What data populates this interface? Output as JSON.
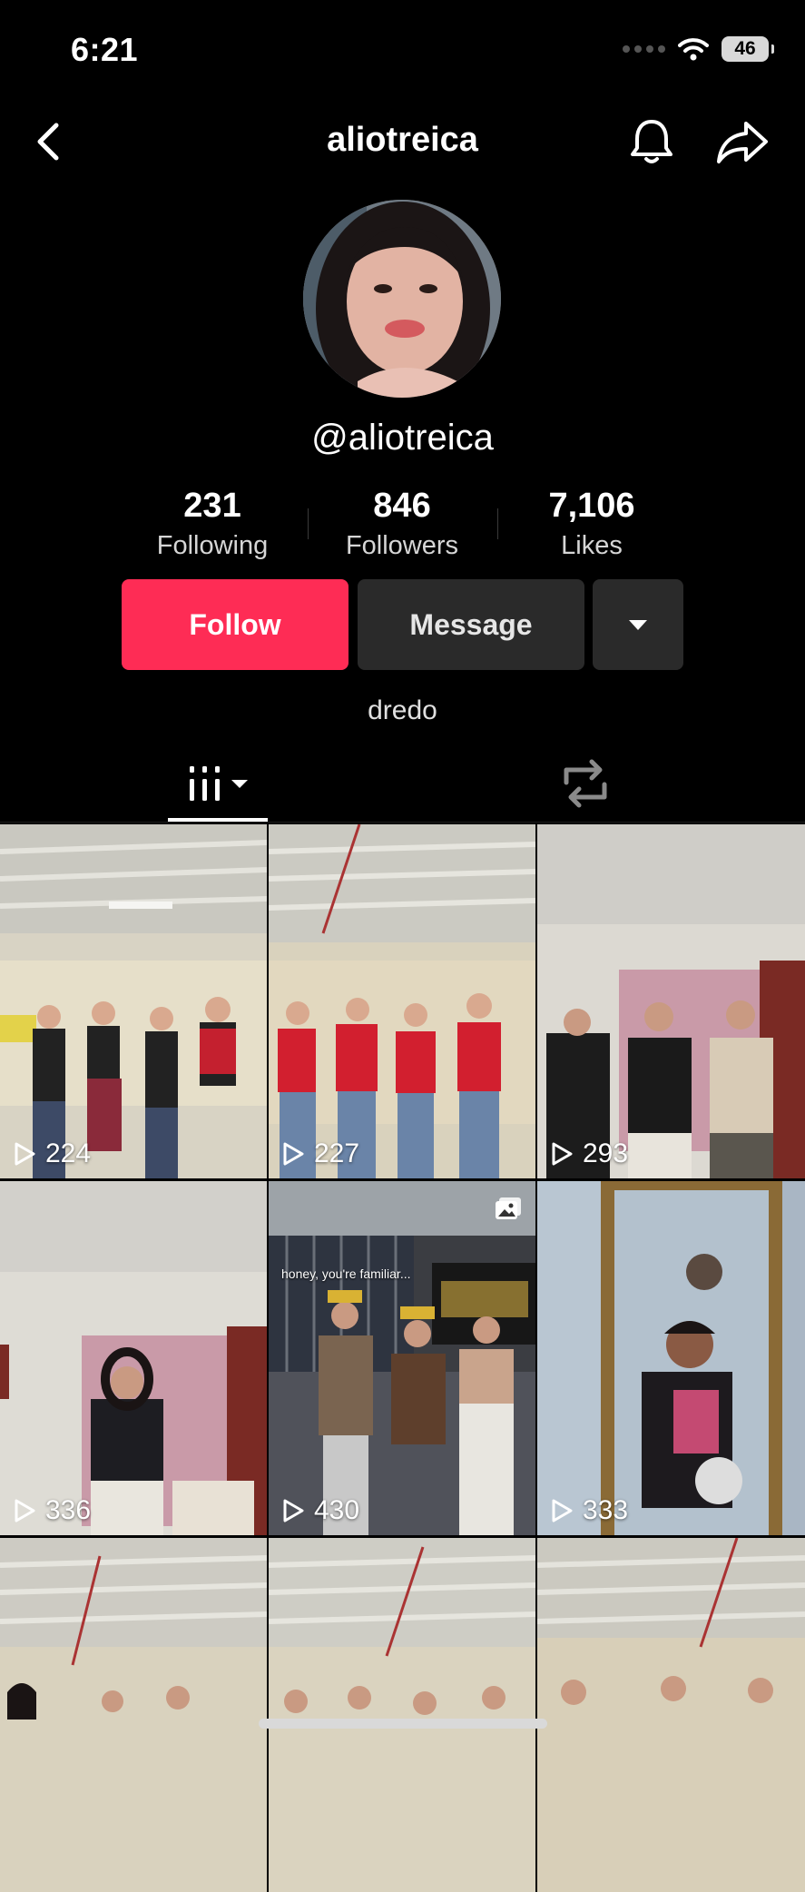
{
  "status_bar": {
    "time": "6:21",
    "battery": "46"
  },
  "header": {
    "title": "aliotreica"
  },
  "profile": {
    "handle": "@aliotreica",
    "bio": "dredo",
    "stats": [
      {
        "value": "231",
        "label": "Following"
      },
      {
        "value": "846",
        "label": "Followers"
      },
      {
        "value": "7,106",
        "label": "Likes"
      }
    ]
  },
  "actions": {
    "follow": "Follow",
    "message": "Message"
  },
  "colors": {
    "follow": "#fe2c55",
    "secondary_button": "#2a2a2a",
    "background": "#000000"
  },
  "grid": {
    "tiles": [
      {
        "views": "224"
      },
      {
        "views": "227"
      },
      {
        "views": "293"
      },
      {
        "views": "336"
      },
      {
        "views": "430",
        "caption": "honey, you're familiar...",
        "is_photo": true
      },
      {
        "views": "333"
      },
      {
        "views": ""
      },
      {
        "views": ""
      },
      {
        "views": ""
      }
    ]
  }
}
